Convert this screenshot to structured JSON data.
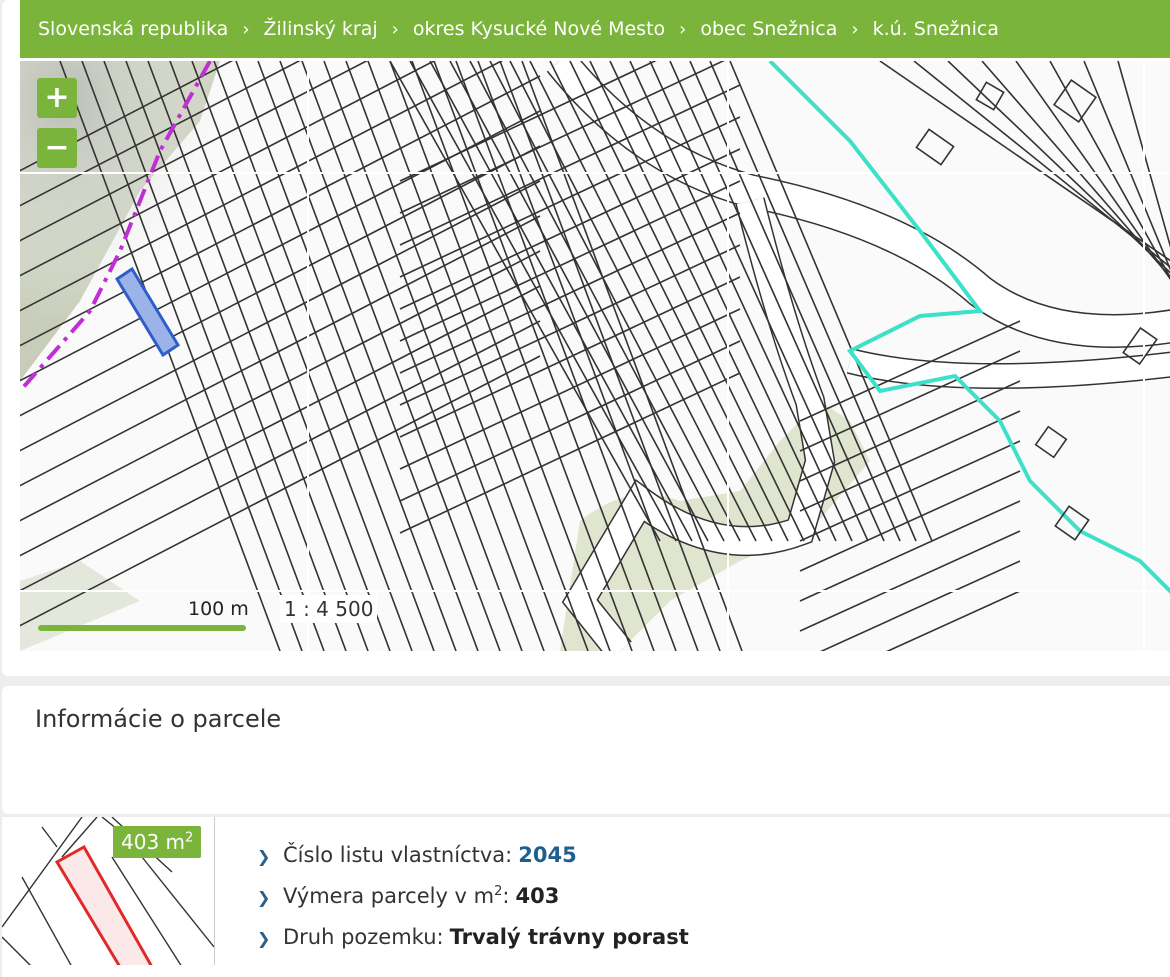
{
  "breadcrumb": [
    "Slovenská republika",
    "Žilinský kraj",
    "okres Kysucké Nové Mesto",
    "obec Snežnica",
    "k.ú. Snežnica"
  ],
  "breadcrumb_separator": "›",
  "map": {
    "zoom_in_label": "+",
    "zoom_out_label": "−",
    "scale_label": "100 m",
    "scale_ratio": "1 : 4 500",
    "colors": {
      "accent": "#7bb43a",
      "boundary": "#3de0c8",
      "district_line": "#c02fd6",
      "selected_parcel": "#3a6fd8"
    }
  },
  "info": {
    "title": "Informácie o parcele"
  },
  "detail": {
    "area_badge_value": "403 m",
    "area_badge_sup": "2",
    "rows": [
      {
        "label": "Číslo listu vlastníctva:",
        "value": "2045"
      },
      {
        "label": "Výmera parcely v m",
        "label_sup": "2",
        "label_suffix": ":",
        "value": "403"
      },
      {
        "label": "Druh pozemku:",
        "value": "Trvalý trávny porast"
      }
    ]
  }
}
